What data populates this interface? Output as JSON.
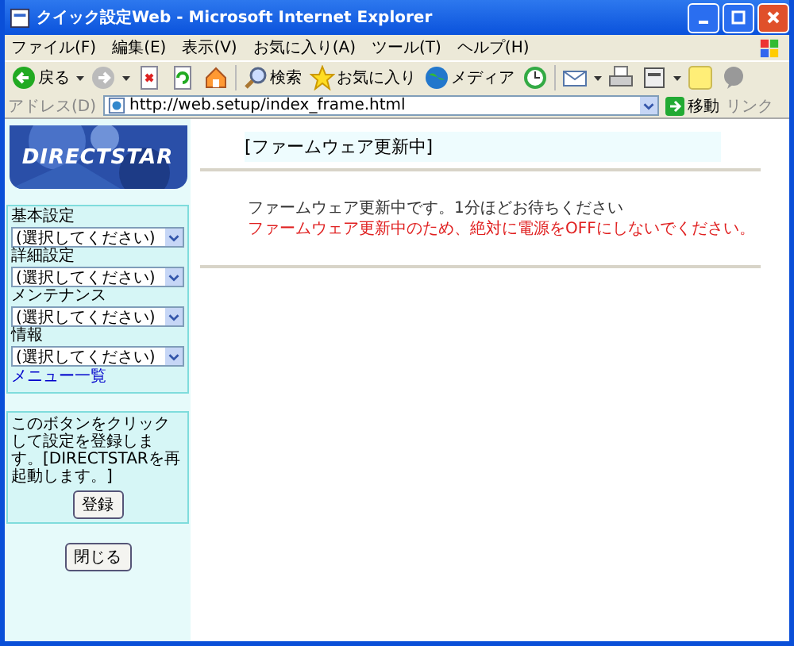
{
  "window": {
    "title": "クイック設定Web - Microsoft Internet Explorer"
  },
  "menu": [
    "ファイル(F)",
    "編集(E)",
    "表示(V)",
    "お気に入り(A)",
    "ツール(T)",
    "ヘルプ(H)"
  ],
  "toolbar": [
    {
      "kind": "back",
      "label": "戻る"
    },
    {
      "kind": "forward"
    },
    {
      "kind": "stop"
    },
    {
      "kind": "refresh"
    },
    {
      "kind": "home"
    },
    {
      "kind": "search",
      "label": "検索"
    },
    {
      "kind": "favorites",
      "label": "お気に入り"
    },
    {
      "kind": "media",
      "label": "メディア"
    },
    {
      "kind": "history"
    },
    {
      "kind": "mail"
    },
    {
      "kind": "print"
    },
    {
      "kind": "edit"
    },
    {
      "kind": "note"
    },
    {
      "kind": "messenger"
    }
  ],
  "address": {
    "label": "アドレス(D)",
    "url": "http://web.setup/index_frame.html",
    "go": "移動",
    "links": "リンク"
  },
  "sidebar": {
    "logo": "DIRECTSTAR",
    "sections": [
      {
        "label": "基本設定",
        "value": "(選択してください)"
      },
      {
        "label": "詳細設定",
        "value": "(選択してください)"
      },
      {
        "label": "メンテナンス",
        "value": "(選択してください)"
      },
      {
        "label": "情報",
        "value": "(選択してください)"
      }
    ],
    "menu_link": "メニュー一覧",
    "note": "このボタンをクリックして設定を登録します。[DIRECTSTARを再起動します。]",
    "register": "登録",
    "close": "閉じる"
  },
  "main": {
    "heading": "[ファームウェア更新中]",
    "messages": [
      {
        "kind": "normal",
        "text": "ファームウェア更新中です。1分ほどお待ちください"
      },
      {
        "kind": "warning",
        "text": "ファームウェア更新中のため、絶対に電源をOFFにしないでください。"
      }
    ]
  }
}
